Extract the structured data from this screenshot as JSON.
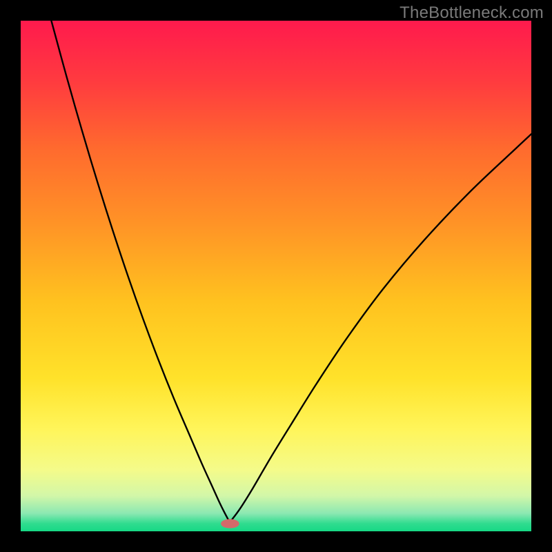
{
  "watermark": "TheBottleneck.com",
  "chart_data": {
    "type": "line",
    "title": "",
    "xlabel": "",
    "ylabel": "",
    "xlim": [
      0,
      1
    ],
    "ylim": [
      0,
      1
    ],
    "background_gradient": {
      "stops": [
        {
          "offset": 0.0,
          "color": "#ff1a4d"
        },
        {
          "offset": 0.12,
          "color": "#ff3b3f"
        },
        {
          "offset": 0.25,
          "color": "#ff6a2e"
        },
        {
          "offset": 0.4,
          "color": "#ff9426"
        },
        {
          "offset": 0.55,
          "color": "#ffc21f"
        },
        {
          "offset": 0.7,
          "color": "#ffe22a"
        },
        {
          "offset": 0.8,
          "color": "#fff55a"
        },
        {
          "offset": 0.88,
          "color": "#f4fb8a"
        },
        {
          "offset": 0.93,
          "color": "#d3f7a8"
        },
        {
          "offset": 0.965,
          "color": "#8be8b2"
        },
        {
          "offset": 0.985,
          "color": "#2fdc8f"
        },
        {
          "offset": 1.0,
          "color": "#17d885"
        }
      ]
    },
    "minimum_marker": {
      "x": 0.41,
      "y": 0.985,
      "color": "#d46a6a",
      "rx": 0.018,
      "ry": 0.009
    },
    "series": [
      {
        "name": "left-branch",
        "x": [
          0.06,
          0.09,
          0.12,
          0.15,
          0.18,
          0.21,
          0.24,
          0.27,
          0.3,
          0.33,
          0.355,
          0.375,
          0.39,
          0.4,
          0.407
        ],
        "y": [
          0.0,
          0.11,
          0.215,
          0.315,
          0.41,
          0.5,
          0.585,
          0.665,
          0.74,
          0.81,
          0.868,
          0.912,
          0.945,
          0.965,
          0.978
        ]
      },
      {
        "name": "right-branch",
        "x": [
          0.413,
          0.43,
          0.455,
          0.49,
          0.53,
          0.58,
          0.64,
          0.71,
          0.79,
          0.88,
          0.97,
          1.0
        ],
        "y": [
          0.978,
          0.955,
          0.915,
          0.855,
          0.79,
          0.71,
          0.62,
          0.525,
          0.43,
          0.335,
          0.25,
          0.222
        ]
      }
    ]
  }
}
